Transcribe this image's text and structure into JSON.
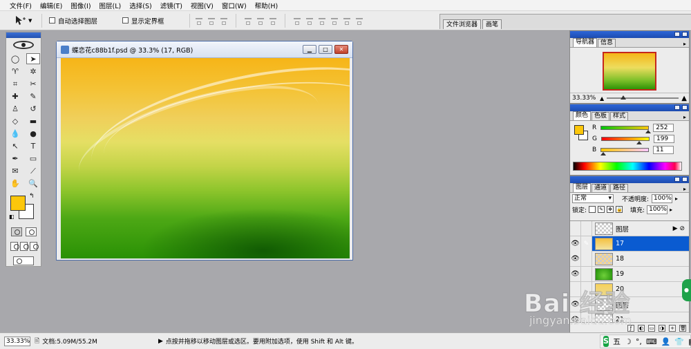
{
  "menubar": {
    "items": [
      "文件(F)",
      "编辑(E)",
      "图像(I)",
      "图层(L)",
      "选择(S)",
      "滤镜(T)",
      "视图(V)",
      "窗口(W)",
      "帮助(H)"
    ]
  },
  "options": {
    "auto_select_label": "自动选择图层",
    "show_bounds_label": "显示定界框",
    "palette_well_tabs": [
      "文件浏览器",
      "画笔"
    ]
  },
  "document": {
    "title": "蝶恋花c88b1f.psd @ 33.3% (17, RGB)"
  },
  "navigator": {
    "tabs": [
      "导航器",
      "信息"
    ],
    "zoom": "33.33%"
  },
  "color": {
    "tabs": [
      "颜色",
      "色板",
      "样式"
    ],
    "channels": [
      {
        "label": "R",
        "value": "252"
      },
      {
        "label": "G",
        "value": "199"
      },
      {
        "label": "B",
        "value": "11"
      }
    ],
    "foreground": "#fcc70b"
  },
  "layers": {
    "tabs": [
      "图层",
      "通道",
      "路径"
    ],
    "blend_mode": "正常",
    "opacity_label": "不透明度:",
    "opacity": "100%",
    "lock_label": "锁定:",
    "fill_label": "填充:",
    "fill": "100%",
    "rows": [
      {
        "name": "图层",
        "visible": false,
        "selected": false
      },
      {
        "name": "17",
        "visible": true,
        "selected": true
      },
      {
        "name": "18",
        "visible": true,
        "selected": false
      },
      {
        "name": "19",
        "visible": true,
        "selected": false
      },
      {
        "name": "20",
        "visible": false,
        "selected": false
      },
      {
        "name": "图层",
        "visible": true,
        "selected": false
      },
      {
        "name": "21",
        "visible": true,
        "selected": false
      }
    ]
  },
  "status": {
    "zoom": "33.33%",
    "doc_size": "文档:5.09M/55.2M",
    "message": "点按并拖移以移动图层或选区。要用附加选项，使用 Shift 和 Alt 键。"
  },
  "watermark": {
    "main": "Bai 经验",
    "sub": "jingyan.baidu.com"
  },
  "ime": {
    "logo": "S",
    "label": "五"
  }
}
